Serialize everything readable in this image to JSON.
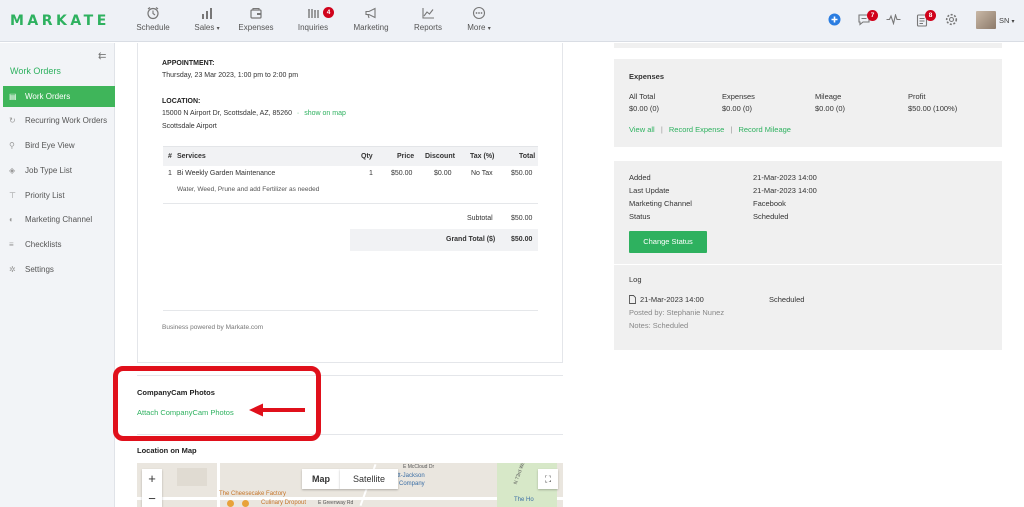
{
  "brand": {
    "logo": "MARKATE",
    "accent": "#2eb15f"
  },
  "nav": {
    "items": [
      {
        "label": "Schedule",
        "icon": "alarm-clock-icon",
        "caret": ""
      },
      {
        "label": "Sales",
        "icon": "sales-chart-icon",
        "caret": "▾"
      },
      {
        "label": "Expenses",
        "icon": "wallet-icon",
        "caret": ""
      },
      {
        "label": "Inquiries",
        "icon": "inquiries-bars-icon",
        "caret": ""
      },
      {
        "label": "Marketing",
        "icon": "megaphone-icon",
        "caret": ""
      },
      {
        "label": "Reports",
        "icon": "line-chart-icon",
        "caret": ""
      },
      {
        "label": "More",
        "icon": "more-dots-icon",
        "caret": "▾"
      }
    ],
    "inquiries_badge": "4",
    "messages_badge": "7",
    "tasks_badge": "8",
    "user_initials": "SN",
    "user_caret": "▾"
  },
  "sidebar": {
    "title": "Work Orders",
    "collapse_glyph": "⇇",
    "items": [
      {
        "label": "Work Orders",
        "icon": "document-icon",
        "glyph": "▤"
      },
      {
        "label": "Recurring Work Orders",
        "icon": "refresh-icon",
        "glyph": "↻"
      },
      {
        "label": "Bird Eye View",
        "icon": "map-pin-icon",
        "glyph": "⚲"
      },
      {
        "label": "Job Type List",
        "icon": "tag-icon",
        "glyph": "◈"
      },
      {
        "label": "Priority List",
        "icon": "pin-icon",
        "glyph": "⊤"
      },
      {
        "label": "Marketing Channel",
        "icon": "channel-icon",
        "glyph": "◐"
      },
      {
        "label": "Checklists",
        "icon": "list-icon",
        "glyph": "≡"
      },
      {
        "label": "Settings",
        "icon": "gear-icon",
        "glyph": "✲"
      }
    ]
  },
  "workorder": {
    "appointment_label": "APPOINTMENT:",
    "appointment_value": "Thursday, 23 Mar 2023, 1:00 pm to 2:00 pm",
    "location_label": "LOCATION:",
    "address": "15000 N Airport Dr, Scottsdale, AZ, 85260",
    "separator": "·",
    "show_on_map": "show on map",
    "place_name": "Scottsdale Airport",
    "table_headers": [
      "#",
      "Services",
      "Qty",
      "Price",
      "Discount",
      "Tax (%)",
      "Total"
    ],
    "line_items": [
      {
        "num": "1",
        "service": "Bi Weekly Garden Maintenance",
        "description": "Water, Weed, Prune and add Fertilizer as needed",
        "qty": "1",
        "price": "$50.00",
        "discount": "$0.00",
        "tax": "No Tax",
        "total": "$50.00"
      }
    ],
    "subtotal_label": "Subtotal",
    "subtotal_value": "$50.00",
    "grand_total_label": "Grand Total ($)",
    "grand_total_value": "$50.00",
    "footer": "Business powered by Markate.com"
  },
  "companycam": {
    "title": "CompanyCam Photos",
    "attach_link": "Attach CompanyCam Photos",
    "highlight_color": "#e0101b"
  },
  "map": {
    "title": "Location on Map",
    "map_tab": "Map",
    "satellite_tab": "Satellite",
    "zoom_in": "+",
    "zoom_out": "−",
    "fullscreen_glyph": "⛶",
    "labels": [
      "The Cheesecake Factory",
      "Culinary Dropout",
      "E Greenway Rd",
      "ritt-Jackson",
      "n Company",
      "E McCloud Dr",
      "The Ho",
      "N 73rd Way"
    ]
  },
  "expenses": {
    "title": "Expenses",
    "columns": [
      {
        "label": "All Total",
        "value": "$0.00 (0)"
      },
      {
        "label": "Expenses",
        "value": "$0.00 (0)"
      },
      {
        "label": "Mileage",
        "value": "$0.00 (0)"
      },
      {
        "label": "Profit",
        "value": "$50.00 (100%)"
      }
    ],
    "links": [
      "View all",
      "Record Expense",
      "Record Mileage"
    ],
    "link_separator": "|"
  },
  "status": {
    "rows": [
      {
        "label": "Added",
        "value": "21-Mar-2023 14:00"
      },
      {
        "label": "Last Update",
        "value": "21-Mar-2023 14:00"
      },
      {
        "label": "Marketing Channel",
        "value": "Facebook"
      },
      {
        "label": "Status",
        "value": "Scheduled"
      }
    ],
    "change_button": "Change Status",
    "log_title": "Log",
    "log_entry": {
      "time": "21-Mar-2023 14:00",
      "status": "Scheduled",
      "posted_by": "Posted by: Stephanie Nunez",
      "notes": "Notes: Scheduled"
    }
  }
}
